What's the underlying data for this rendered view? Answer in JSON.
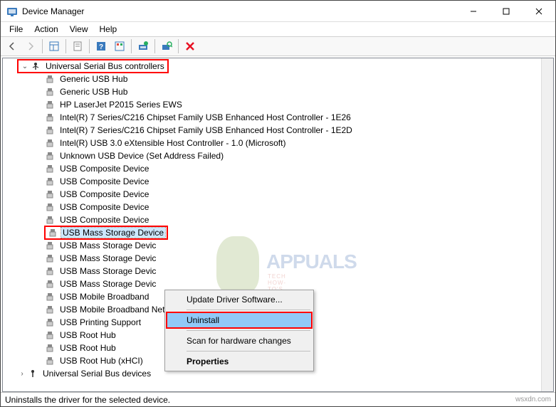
{
  "window": {
    "title": "Device Manager"
  },
  "menu": {
    "file": "File",
    "action": "Action",
    "view": "View",
    "help": "Help"
  },
  "tree": {
    "category": "Universal Serial Bus controllers",
    "items": [
      "Generic USB Hub",
      "Generic USB Hub",
      "HP LaserJet P2015 Series EWS",
      "Intel(R) 7 Series/C216 Chipset Family USB Enhanced Host Controller - 1E26",
      "Intel(R) 7 Series/C216 Chipset Family USB Enhanced Host Controller - 1E2D",
      "Intel(R) USB 3.0 eXtensible Host Controller - 1.0 (Microsoft)",
      "Unknown USB Device (Set Address Failed)",
      "USB Composite Device",
      "USB Composite Device",
      "USB Composite Device",
      "USB Composite Device",
      "USB Composite Device"
    ],
    "selected": "USB Mass Storage Device",
    "after_items": [
      "USB Mass Storage Devic",
      "USB Mass Storage Devic",
      "USB Mass Storage Devic",
      "USB Mass Storage Devic",
      "USB Mobile Broadband",
      "USB Mobile Broadband Network Adapter Module",
      "USB Printing Support",
      "USB Root Hub",
      "USB Root Hub",
      "USB Root Hub (xHCI)"
    ],
    "next_category": "Universal Serial Bus devices"
  },
  "context_menu": {
    "update": "Update Driver Software...",
    "uninstall": "Uninstall",
    "scan": "Scan for hardware changes",
    "properties": "Properties"
  },
  "statusbar": {
    "text": "Uninstalls the driver for the selected device.",
    "brand": "wsxdn.com"
  },
  "watermark": {
    "name": "APPUALS",
    "tagline": "TECH HOW-TO'S FROM THE EXPERTS"
  }
}
